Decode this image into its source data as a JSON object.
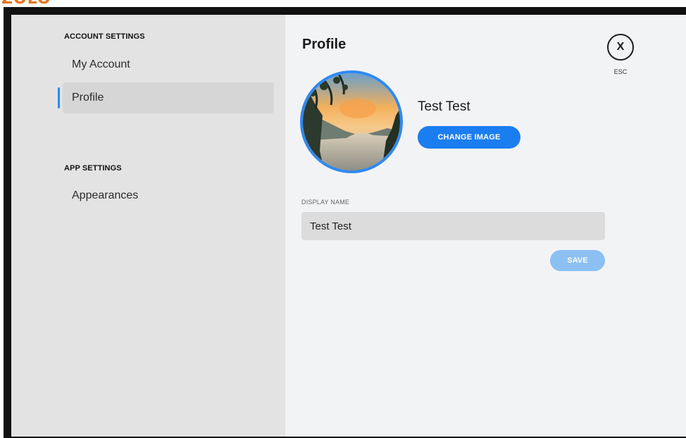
{
  "logo": {
    "text": "ZOLO"
  },
  "sidebar": {
    "account_settings_header": "ACCOUNT SETTINGS",
    "app_settings_header": "APP SETTINGS",
    "items": [
      {
        "label": "My Account"
      },
      {
        "label": "Profile",
        "selected": true
      },
      {
        "label": "Appearances"
      }
    ]
  },
  "main": {
    "title": "Profile",
    "close": {
      "label": "X",
      "hint": "ESC"
    },
    "profile": {
      "name": "Test Test",
      "change_image_label": "CHANGE IMAGE"
    },
    "display_name": {
      "label": "DISPLAY NAME",
      "value": "Test Test"
    },
    "save_label": "SAVE"
  },
  "colors": {
    "accent": "#1a7ef0",
    "accent_disabled": "#8cc0f3",
    "sidebar_bg": "#e3e3e3",
    "main_bg": "#f2f3f5",
    "selected_indicator": "#2f89f2"
  }
}
